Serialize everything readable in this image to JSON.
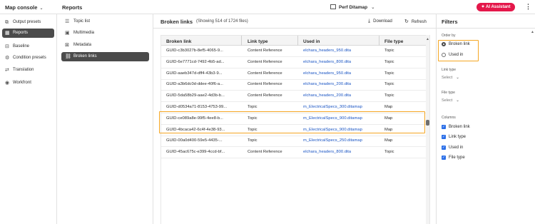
{
  "topbar": {
    "console_label": "Map console",
    "reports_title": "Reports",
    "map_name": "Perf Ditamap",
    "ai_button": "AI Assistant",
    "more": "⋮"
  },
  "leftnav": {
    "items": [
      {
        "label": "Output presets",
        "icon": "output-icon"
      },
      {
        "label": "Reports",
        "icon": "reports-icon",
        "active": true
      },
      {
        "label": "Baseline",
        "icon": "baseline-icon"
      },
      {
        "label": "Condition presets",
        "icon": "condition-icon"
      },
      {
        "label": "Translation",
        "icon": "translation-icon"
      },
      {
        "label": "Workfront",
        "icon": "workfront-icon"
      }
    ]
  },
  "subnav": {
    "items": [
      {
        "label": "Topic list",
        "icon": "list-icon"
      },
      {
        "label": "Multimedia",
        "icon": "multimedia-icon"
      },
      {
        "label": "Metadata",
        "icon": "metadata-icon"
      },
      {
        "label": "Broken links",
        "icon": "broken-link-icon",
        "active": true
      }
    ]
  },
  "main": {
    "title": "Broken links",
    "showing": "(Showing 514 of 1724 files)",
    "download": "Download",
    "refresh": "Refresh",
    "columns": [
      "Broken link",
      "Link type",
      "Used in",
      "File type"
    ],
    "rows": [
      [
        "GUID-c3b3027b-8ef5-4065-9...",
        "Content Reference",
        "elchara_headers_950.dita",
        "Topic"
      ],
      [
        "GUID-6e7771cd-7492-4b5-ad...",
        "Content Reference",
        "elchara_headers_800.dita",
        "Topic"
      ],
      [
        "GUID-aaeb347d-dff4-43b3-9...",
        "Content Reference",
        "elchara_headers_950.dita",
        "Topic"
      ],
      [
        "GUID-a3b6dc0d-ddee-40f6-a...",
        "Content Reference",
        "elchara_headers_200.dita",
        "Topic"
      ],
      [
        "GUID-5da58b29-aae2-4d3b-b...",
        "Content Reference",
        "elchara_headers_200.dita",
        "Topic"
      ],
      [
        "GUID-d0534a71-8153-4753-99...",
        "Topic",
        "m_ElectricalSpecs_300.ditamap",
        "Map"
      ],
      [
        "GUID-ce089a8e-99f5-4ee8-b...",
        "Topic",
        "m_ElectricalSpecs_900.ditamap",
        "Map"
      ],
      [
        "GUID-4bcaca42-6c4f-4e38-93...",
        "Topic",
        "m_ElectricalSpecs_900.ditamap",
        "Map"
      ],
      [
        "GUID-00a0d400-59e5-4435-...",
        "Topic",
        "m_ElectricalSpecs_250.ditamap",
        "Map"
      ],
      [
        "GUID-45ac675c-e399-4ccd-bf...",
        "Content Reference",
        "elchara_headers_800.dita",
        "Topic"
      ]
    ]
  },
  "filters": {
    "title": "Filters",
    "order_by_label": "Order by",
    "order_options": [
      "Broken link",
      "Used in"
    ],
    "order_selected": "Broken link",
    "link_type_label": "Link type",
    "link_type_value": "Select",
    "file_type_label": "File type",
    "file_type_value": "Select",
    "columns_label": "Columns",
    "column_options": [
      {
        "label": "Broken link",
        "checked": true
      },
      {
        "label": "Link type",
        "checked": true
      },
      {
        "label": "Used in",
        "checked": true
      },
      {
        "label": "File type",
        "checked": true
      }
    ]
  }
}
